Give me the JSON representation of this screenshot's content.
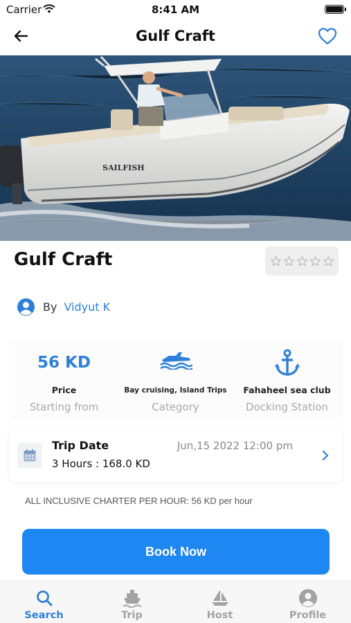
{
  "status_bar": {
    "carrier": "Carrier",
    "time": "8:41 AM"
  },
  "nav": {
    "title": "Gulf Craft"
  },
  "boat": {
    "title": "Gulf Craft",
    "hull_text": "SAILFISH",
    "rating": 0,
    "rating_max": 5
  },
  "owner": {
    "by_label": "By",
    "name": "Vidyut K"
  },
  "info": {
    "price": {
      "value": "56 KD",
      "label": "Price",
      "sub": "Starting from"
    },
    "category": {
      "value": "Bay cruising, Island Trips",
      "sub": "Category"
    },
    "docking": {
      "value": "Fahaheel sea club",
      "sub": "Docking Station"
    }
  },
  "trip": {
    "label": "Trip Date",
    "date": "Jun,15 2022 12:00 pm",
    "duration": "3 Hours : 168.0 KD"
  },
  "charter_note": "ALL INCLUSIVE CHARTER PER HOUR: 56 KD per hour",
  "book_button": "Book Now",
  "tabs": [
    {
      "label": "Search",
      "icon": "search-icon",
      "active": true
    },
    {
      "label": "Trip",
      "icon": "ship-icon",
      "active": false
    },
    {
      "label": "Host",
      "icon": "sailboat-icon",
      "active": false
    },
    {
      "label": "Profile",
      "icon": "profile-icon",
      "active": false
    }
  ],
  "colors": {
    "accent": "#1f87f2",
    "link": "#2e7fd9",
    "inactive": "#a3a3a3"
  }
}
